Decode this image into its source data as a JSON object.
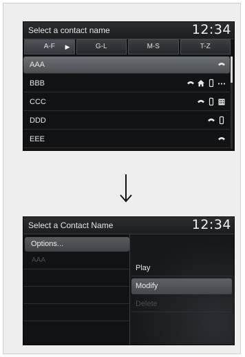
{
  "screen1": {
    "title": "Select a contact name",
    "clock": "12:34",
    "tabs": [
      "A-F",
      "G-L",
      "M-S",
      "T-Z"
    ],
    "tab_arrow": "▶",
    "contacts": [
      {
        "name": "AAA",
        "icons": [
          "phone-icon"
        ]
      },
      {
        "name": "BBB",
        "icons": [
          "phone-icon",
          "home-icon",
          "mobile-icon",
          "more-icon"
        ]
      },
      {
        "name": "CCC",
        "icons": [
          "phone-icon",
          "mobile-icon",
          "work-icon"
        ]
      },
      {
        "name": "DDD",
        "icons": [
          "phone-icon",
          "mobile-icon"
        ]
      },
      {
        "name": "EEE",
        "icons": [
          "phone-icon"
        ]
      }
    ]
  },
  "screen2": {
    "title": "Select a Contact Name",
    "clock": "12:34",
    "options_label": "Options...",
    "contact": "AAA",
    "menu": [
      {
        "label": "Play",
        "state": "normal"
      },
      {
        "label": "Modify",
        "state": "selected"
      },
      {
        "label": "Delete",
        "state": "disabled"
      }
    ]
  }
}
